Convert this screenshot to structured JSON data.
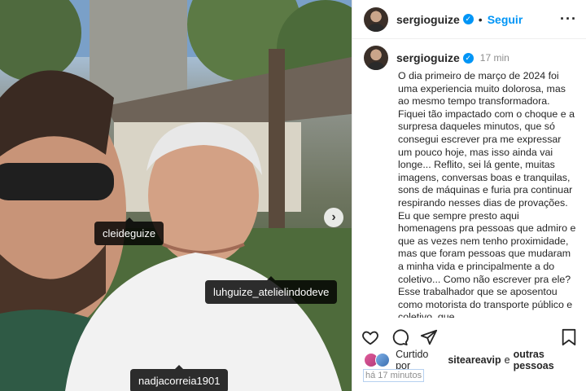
{
  "post": {
    "username": "sergioguize",
    "verified": true,
    "follow_label": "Seguir",
    "more_icon": "ellipsis-icon",
    "time": "17 min",
    "caption": "O dia primeiro de março de 2024 foi uma experiencia muito dolorosa, mas ao mesmo tempo transformadora. Fiquei tão impactado com o choque e a surpresa daqueles minutos, que só consegui escrever pra me expressar um pouco hoje, mas isso ainda vai longe... Reflito, sei lá gente, muitas imagens, conversas boas e tranquilas, sons de máquinas e furia pra continuar respirando nesses dias de provações. Eu que sempre presto aqui homenagens pra pessoas que admiro e que as vezes nem tenho proximidade, mas que foram pessoas que mudaram a minha vida e principalmente a do coletivo... Como não escrever pra ele? Esse trabalhador que se aposentou como motorista do transporte público e coletivo, que",
    "liked_by_prefix": "Curtido por",
    "liked_by_user": "siteareavip",
    "liked_by_join": "e",
    "liked_by_others": "outras pessoas",
    "posted_ago": "há 17 minutos"
  },
  "photo": {
    "tags": [
      "cleideguize",
      "luhguize_atelielindodeve",
      "nadjacorreia1901"
    ],
    "next_icon": "chevron-right-icon"
  },
  "icons": [
    "heart-icon",
    "comment-icon",
    "share-icon",
    "bookmark-icon",
    "verified-badge-icon"
  ],
  "colors": {
    "accent": "#0095f6",
    "text": "#262626",
    "muted": "#8e8e8e",
    "tag_bg": "#000000"
  }
}
